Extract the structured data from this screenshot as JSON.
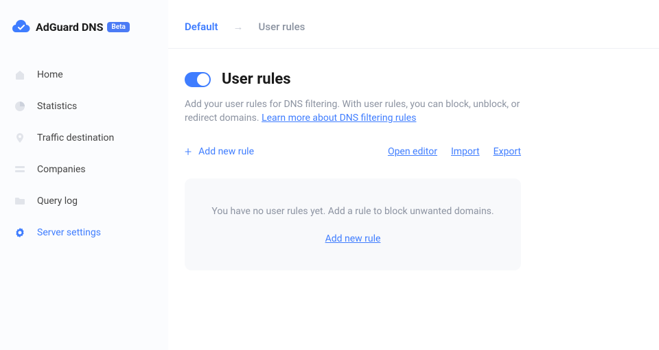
{
  "logo": {
    "brand": "AdGuard DNS",
    "badge": "Beta"
  },
  "nav": {
    "items": [
      {
        "label": "Home"
      },
      {
        "label": "Statistics"
      },
      {
        "label": "Traffic destination"
      },
      {
        "label": "Companies"
      },
      {
        "label": "Query log"
      },
      {
        "label": "Server settings"
      }
    ]
  },
  "breadcrumb": {
    "root": "Default",
    "current": "User rules"
  },
  "title": "User rules",
  "description": {
    "text": "Add your user rules for DNS filtering. With user rules, you can block, unblock, or redirect domains. ",
    "link": "Learn more about DNS filtering rules"
  },
  "actions": {
    "add": "Add new rule",
    "open_editor": "Open editor",
    "import": "Import",
    "export": "Export"
  },
  "empty": {
    "text": "You have no user rules yet. Add a rule to block unwanted domains.",
    "link": "Add new rule"
  }
}
